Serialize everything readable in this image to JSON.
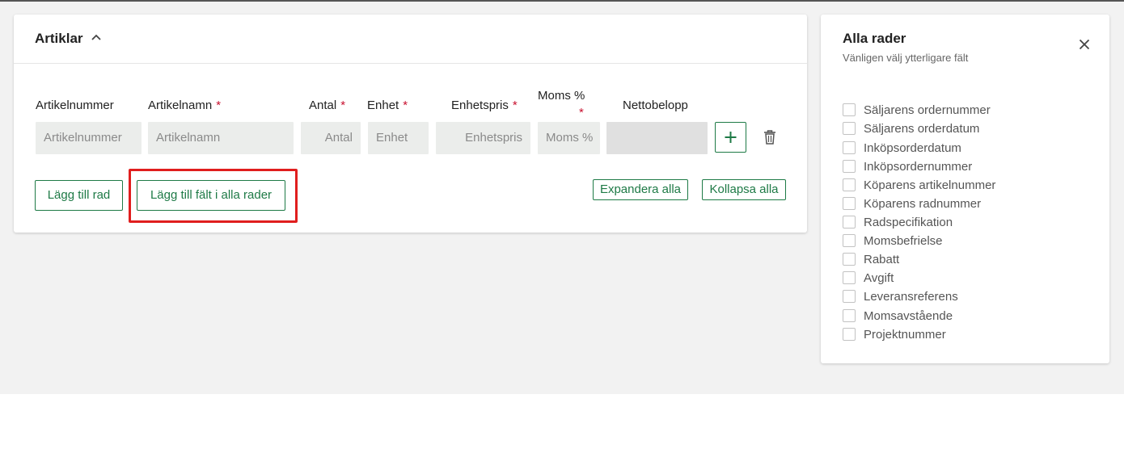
{
  "articles": {
    "title": "Artiklar",
    "columns": {
      "artikelnummer": {
        "label": "Artikelnummer",
        "placeholder": "Artikelnummer",
        "required": false
      },
      "artikelnamn": {
        "label": "Artikelnamn",
        "placeholder": "Artikelnamn",
        "required": true
      },
      "antal": {
        "label": "Antal",
        "placeholder": "Antal",
        "required": true
      },
      "enhet": {
        "label": "Enhet",
        "placeholder": "Enhet",
        "required": true
      },
      "enhetspris": {
        "label": "Enhetspris",
        "placeholder": "Enhetspris",
        "required": true
      },
      "moms": {
        "label": "Moms %",
        "placeholder": "Moms %",
        "required": true
      },
      "nettobelopp": {
        "label": "Nettobelopp",
        "value": ""
      }
    },
    "required_marker": "*",
    "buttons": {
      "add_row": "Lägg till rad",
      "add_field_all_rows": "Lägg till fält i alla rader",
      "expand_all": "Expandera alla",
      "collapse_all": "Kollapsa alla"
    }
  },
  "panel": {
    "title": "Alla rader",
    "subtitle": "Vänligen välj ytterligare fält",
    "options": [
      "Säljarens ordernummer",
      "Säljarens orderdatum",
      "Inköpsorderdatum",
      "Inköpsordernummer",
      "Köparens artikelnummer",
      "Köparens radnummer",
      "Radspecifikation",
      "Momsbefrielse",
      "Rabatt",
      "Avgift",
      "Leveransreferens",
      "Momsavstående",
      "Projektnummer"
    ]
  },
  "colors": {
    "accent_green": "#1e7a46",
    "required_red": "#c8102e",
    "highlight_red": "#e01e1e"
  },
  "icons": [
    "chevron-up-icon",
    "plus-icon",
    "trash-icon",
    "close-icon"
  ]
}
